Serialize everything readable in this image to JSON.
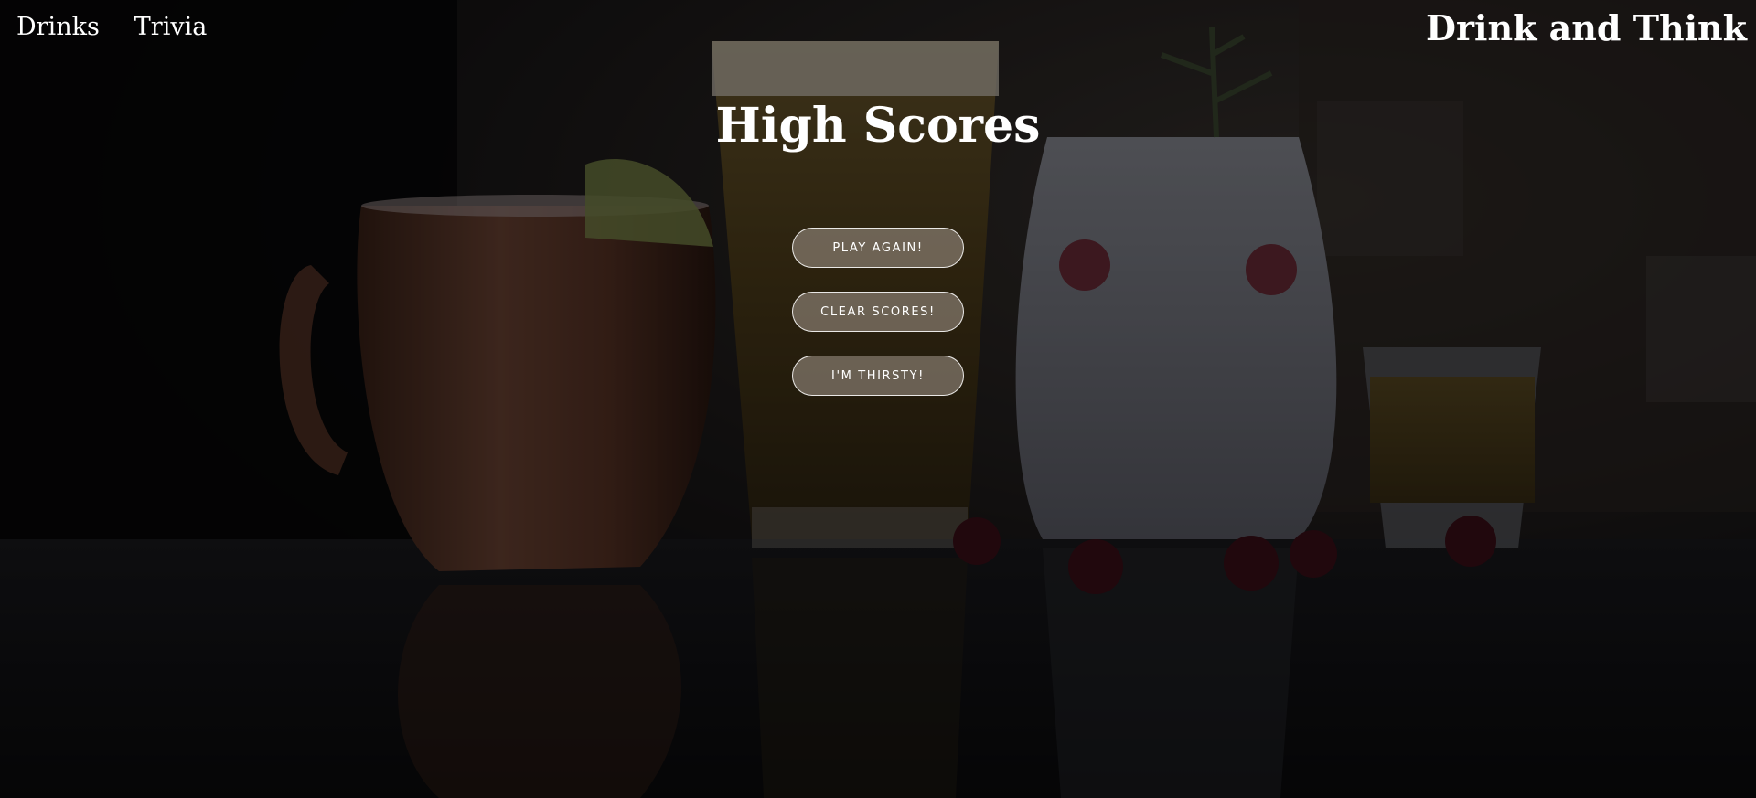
{
  "nav": {
    "items": [
      {
        "label": "Drinks"
      },
      {
        "label": "Trivia"
      }
    ]
  },
  "brand": {
    "title": "Drink and Think"
  },
  "main": {
    "heading": "High Scores",
    "buttons": [
      {
        "label": "PLAY AGAIN!"
      },
      {
        "label": "CLEAR SCORES!"
      },
      {
        "label": "I'M THIRSTY!"
      }
    ]
  },
  "theme": {
    "text_color": "#ffffff",
    "button_fill": "#968a80",
    "background": "#0c0c0e"
  }
}
